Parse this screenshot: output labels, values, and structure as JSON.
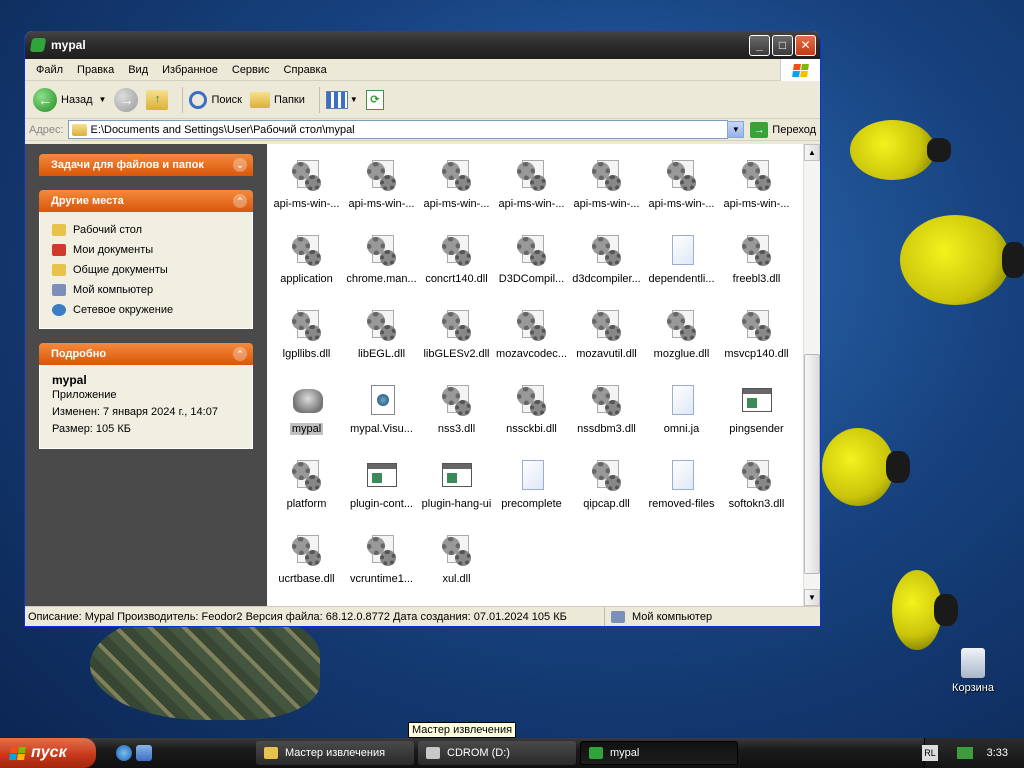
{
  "desktop": {
    "icons": [
      {
        "label": "Корзина"
      }
    ]
  },
  "window": {
    "title": "mypal",
    "menu": [
      "Файл",
      "Правка",
      "Вид",
      "Избранное",
      "Сервис",
      "Справка"
    ],
    "toolbar": {
      "back": "Назад",
      "search": "Поиск",
      "folders": "Папки"
    },
    "address": {
      "label": "Адрес:",
      "value": "E:\\Documents and Settings\\User\\Рабочий стол\\mypal",
      "go": "Переход"
    },
    "taskpane": {
      "tasks_title": "Задачи для файлов и папок",
      "places_title": "Другие места",
      "places": [
        "Рабочий стол",
        "Мои документы",
        "Общие документы",
        "Мой компьютер",
        "Сетевое окружение"
      ],
      "details_title": "Подробно",
      "details": {
        "name": "mypal",
        "type": "Приложение",
        "modified": "Изменен: 7 января 2024 г., 14:07",
        "size": "Размер: 105 КБ"
      }
    },
    "files": [
      {
        "name": "api-ms-win-...",
        "icon": "gear"
      },
      {
        "name": "api-ms-win-...",
        "icon": "gear"
      },
      {
        "name": "api-ms-win-...",
        "icon": "gear"
      },
      {
        "name": "api-ms-win-...",
        "icon": "gear"
      },
      {
        "name": "api-ms-win-...",
        "icon": "gear"
      },
      {
        "name": "api-ms-win-...",
        "icon": "gear"
      },
      {
        "name": "api-ms-win-...",
        "icon": "gear"
      },
      {
        "name": "application",
        "icon": "gear-page"
      },
      {
        "name": "chrome.man...",
        "icon": "gear"
      },
      {
        "name": "concrt140.dll",
        "icon": "gear"
      },
      {
        "name": "D3DCompil...",
        "icon": "gear"
      },
      {
        "name": "d3dcompiler...",
        "icon": "gear"
      },
      {
        "name": "dependentli...",
        "icon": "blank"
      },
      {
        "name": "freebl3.dll",
        "icon": "gear"
      },
      {
        "name": "lgpllibs.dll",
        "icon": "gear"
      },
      {
        "name": "libEGL.dll",
        "icon": "gear"
      },
      {
        "name": "libGLESv2.dll",
        "icon": "gear"
      },
      {
        "name": "mozavcodec...",
        "icon": "gear"
      },
      {
        "name": "mozavutil.dll",
        "icon": "gear"
      },
      {
        "name": "mozglue.dll",
        "icon": "gear"
      },
      {
        "name": "msvcp140.dll",
        "icon": "gear"
      },
      {
        "name": "mypal",
        "icon": "app",
        "selected": true
      },
      {
        "name": "mypal.Visu...",
        "icon": "script"
      },
      {
        "name": "nss3.dll",
        "icon": "gear"
      },
      {
        "name": "nssckbi.dll",
        "icon": "gear"
      },
      {
        "name": "nssdbm3.dll",
        "icon": "gear"
      },
      {
        "name": "omni.ja",
        "icon": "blank"
      },
      {
        "name": "pingsender",
        "icon": "app-window"
      },
      {
        "name": "platform",
        "icon": "gear-page"
      },
      {
        "name": "plugin-cont...",
        "icon": "app-window"
      },
      {
        "name": "plugin-hang-ui",
        "icon": "app-window"
      },
      {
        "name": "precomplete",
        "icon": "blank"
      },
      {
        "name": "qipcap.dll",
        "icon": "gear"
      },
      {
        "name": "removed-files",
        "icon": "blank"
      },
      {
        "name": "softokn3.dll",
        "icon": "gear"
      },
      {
        "name": "ucrtbase.dll",
        "icon": "gear"
      },
      {
        "name": "vcruntime1...",
        "icon": "gear"
      },
      {
        "name": "xul.dll",
        "icon": "gear"
      }
    ],
    "status": {
      "description": "Описание: Mypal Производитель: Feodor2 Версия файла: 68.12.0.8772 Дата создания: 07.01.2024 105 КБ",
      "location": "Мой компьютер"
    }
  },
  "tooltip": "Мастер извлечения",
  "taskbar": {
    "start": "пуск",
    "tasks": [
      "Мастер извлечения",
      "CDROM (D:)",
      "mypal"
    ],
    "lang": "RL",
    "clock": "3:33"
  }
}
